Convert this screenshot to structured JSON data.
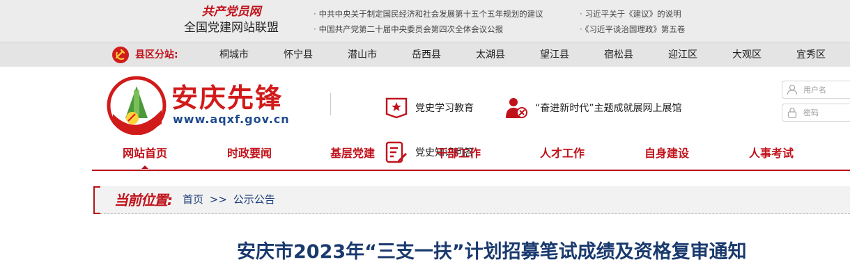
{
  "top": {
    "alliance_logo_text": "共产党员网",
    "alliance_title": "全国党建网站联盟",
    "links_col1": [
      "中共中央关于制定国民经济和社会发展第十五个五年规划的建议",
      "中国共产党第二十届中央委员会第四次全体会议公报"
    ],
    "links_col2": [
      "习近平关于《建议》的说明",
      "《习近平谈治国理政》第五卷"
    ]
  },
  "county": {
    "label": "县区分站:",
    "items": [
      "桐城市",
      "怀宁县",
      "潜山市",
      "岳西县",
      "太湖县",
      "望江县",
      "宿松县",
      "迎江区",
      "大观区",
      "宜秀区"
    ]
  },
  "header": {
    "site_name": "安庆先锋",
    "site_url": "www.aqxf.gov.cn",
    "features": [
      {
        "label": "党史学习教育",
        "icon": "book-star-icon"
      },
      {
        "label": "“奋进新时代”主题成就展网上展馆",
        "icon": "party-member-icon"
      },
      {
        "label": "党史知识问答",
        "icon": "quiz-pen-icon"
      }
    ],
    "login": {
      "username_placeholder": "用户名",
      "password_placeholder": "密码"
    }
  },
  "nav": {
    "items": [
      "网站首页",
      "时政要闻",
      "基层党建",
      "干部工作",
      "人才工作",
      "自身建设",
      "人事考试"
    ],
    "active_index": 0
  },
  "breadcrumb": {
    "label": "当前位置:",
    "home": "首页",
    "separator": ">>",
    "current": "公示公告"
  },
  "article": {
    "title": "安庆市2023年“三支一扶”计划招募笔试成绩及资格复审通知"
  },
  "colors": {
    "brand_red": "#c0121b",
    "link_blue": "#1e3f7a"
  }
}
